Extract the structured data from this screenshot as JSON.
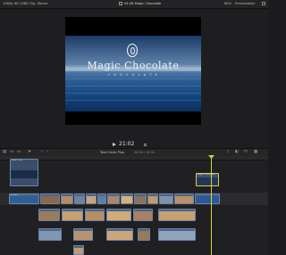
{
  "window": {
    "left_info": "1080p HD 1080 25p, Stereo",
    "title": "04-08 Magic Chocolate",
    "zoom": "60%",
    "view_menu": "Presentation"
  },
  "viewer": {
    "overlay_title": "Magic Chocolate",
    "overlay_subtitle": "C H O C O L A T E"
  },
  "transport": {
    "timecode": "21:02",
    "play_icon": "play-icon"
  },
  "toolbar": {
    "project_name": "Text Circle Plus",
    "duration": "00:00 / 10:00"
  },
  "timeline": {
    "connected_clip_label": "Basic Title",
    "selected_clip_label": "Magic Chocolate",
    "primary_clip_label": "Ocean",
    "colors": {
      "clip_blue": "#4a6489",
      "clip_selected_border": "#e3c94a",
      "playhead": "#d8cf3a"
    }
  }
}
